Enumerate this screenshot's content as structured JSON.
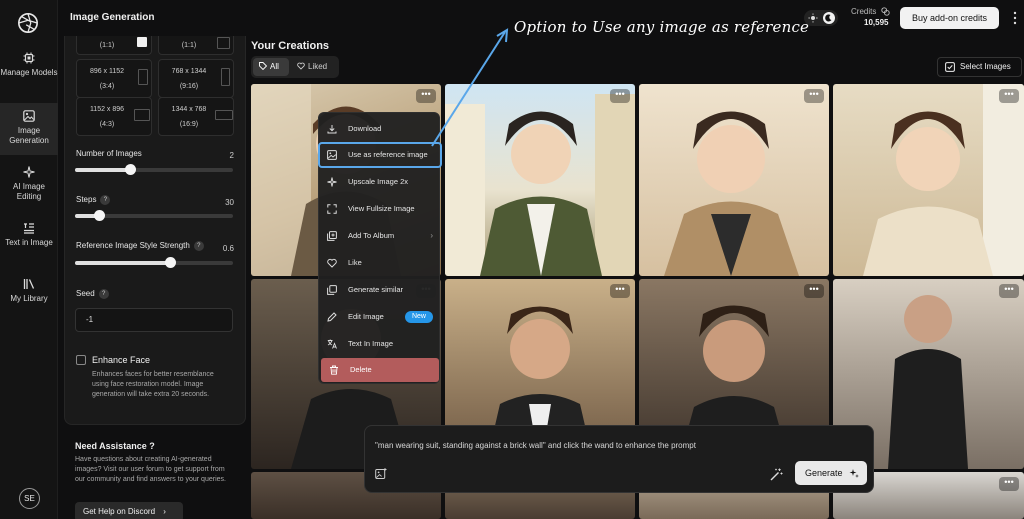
{
  "rail": {
    "items": [
      {
        "label": "Manage Models"
      },
      {
        "label": "Image Generation"
      },
      {
        "label": "AI Image Editing"
      },
      {
        "label": "Text in Image"
      },
      {
        "label": "My Library"
      }
    ],
    "avatar": "SE"
  },
  "topbar": {
    "title": "Image Generation",
    "credits_label": "Credits",
    "credits_value": "10,595",
    "buy_label": "Buy add-on credits"
  },
  "panel": {
    "ratios": [
      {
        "dims": "",
        "aspect": "(1:1)"
      },
      {
        "dims": "",
        "aspect": "(1:1)"
      },
      {
        "dims": "896 x 1152",
        "aspect": "(3:4)"
      },
      {
        "dims": "768 x 1344",
        "aspect": "(9:16)"
      },
      {
        "dims": "1152 x 896",
        "aspect": "(4:3)"
      },
      {
        "dims": "1344 x 768",
        "aspect": "(16:9)"
      }
    ],
    "num_images": {
      "label": "Number of Images",
      "value": "2",
      "fraction": 0.35
    },
    "steps": {
      "label": "Steps",
      "value": "30",
      "fraction": 0.15
    },
    "ref_strength": {
      "label": "Reference Image Style Strength",
      "value": "0.6",
      "fraction": 0.6
    },
    "seed": {
      "label": "Seed",
      "value": "-1"
    },
    "help_glyph": "?",
    "enhance": {
      "title": "Enhance Face",
      "desc": "Enhances faces for better resemblance using face restoration model. Image generation will take extra 20 seconds."
    }
  },
  "assist": {
    "title": "Need Assistance ?",
    "desc": "Have questions about creating AI-generated images? Visit our user forum to get support from our community and find answers to your queries.",
    "discord_label": "Get Help on Discord",
    "discord_chevron": "›"
  },
  "creations": {
    "title": "Your Creations",
    "filters": [
      {
        "label": "All"
      },
      {
        "label": "Liked"
      }
    ],
    "select_label": "Select Images",
    "dots": "•••"
  },
  "menu": {
    "items": [
      {
        "label": "Download"
      },
      {
        "label": "Use as reference image"
      },
      {
        "label": "Upscale Image 2x"
      },
      {
        "label": "View Fullsize Image"
      },
      {
        "label": "Add To Album"
      },
      {
        "label": "Like"
      },
      {
        "label": "Generate similar"
      },
      {
        "label": "Edit Image",
        "badge": "New"
      },
      {
        "label": "Text In Image"
      },
      {
        "label": "Delete"
      }
    ],
    "submenu_chevron": "›"
  },
  "annotation": {
    "text": "Option to Use any image as reference"
  },
  "prompt": {
    "text": "\"man wearing suit, standing against a brick wall\" and click the wand to enhance the prompt",
    "generate_label": "Generate"
  },
  "colors": {
    "accent": "#5aa7ea",
    "badge": "#2596e8",
    "delete": "#b35c5c"
  }
}
